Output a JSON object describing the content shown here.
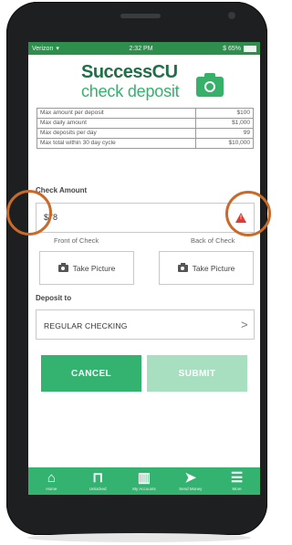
{
  "status_bar": {
    "carrier": "Verizon",
    "time": "2:32 PM",
    "battery": "$ 65%"
  },
  "logo": {
    "title": "SuccessCU",
    "subtitle": "check deposit"
  },
  "limits": [
    {
      "label": "Max amount per deposit",
      "value": "$100"
    },
    {
      "label": "Max daily amount",
      "value": "$1,000"
    },
    {
      "label": "Max deposits per day",
      "value": "99"
    },
    {
      "label": "Max total within 30 day cycle",
      "value": "$10,000"
    }
  ],
  "check_amount": {
    "label": "Check Amount",
    "value": "$78"
  },
  "front_label": "Front of Check",
  "back_label": "Back of Check",
  "take_picture_label": "Take Picture",
  "deposit_to": {
    "label": "Deposit to",
    "value": "REGULAR CHECKING"
  },
  "buttons": {
    "cancel": "CANCEL",
    "submit": "SUBMIT"
  },
  "nav": [
    {
      "label": "Home",
      "icon": "home-icon"
    },
    {
      "label": "Unlocked",
      "icon": "unlock-icon"
    },
    {
      "label": "My Accounts",
      "icon": "bank-icon"
    },
    {
      "label": "Send Money",
      "icon": "send-icon"
    },
    {
      "label": "More",
      "icon": "menu-icon"
    }
  ],
  "colors": {
    "brand_green": "#34b370",
    "status_green": "#2e8f4d",
    "warning_red": "#e23a2e",
    "annotation_orange": "#c86a2a"
  }
}
